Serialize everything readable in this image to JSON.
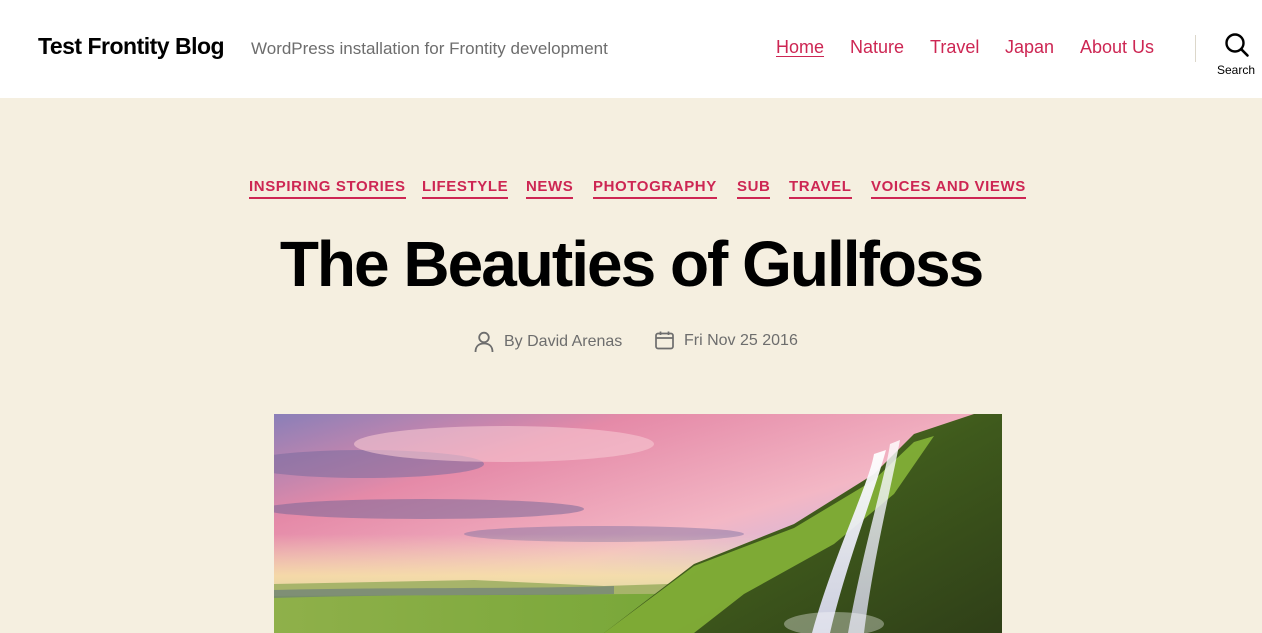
{
  "header": {
    "site_title": "Test Frontity Blog",
    "site_description": "WordPress installation for Frontity development",
    "nav": [
      {
        "label": "Home",
        "active": true
      },
      {
        "label": "Nature",
        "active": false
      },
      {
        "label": "Travel",
        "active": false
      },
      {
        "label": "Japan",
        "active": false
      },
      {
        "label": "About Us",
        "active": false
      }
    ],
    "search_label": "Search",
    "search_icon": "search-icon"
  },
  "post": {
    "categories": [
      "INSPIRING STORIES",
      "LIFESTYLE",
      "NEWS",
      "PHOTOGRAPHY",
      "SUB",
      "TRAVEL",
      "VOICES AND VIEWS"
    ],
    "title": "The Beauties of Gullfoss",
    "author": "By David Arenas",
    "date": "Fri Nov 25 2016",
    "author_icon": "user-icon",
    "date_icon": "calendar-icon",
    "featured_image": "waterfall landscape"
  },
  "colors": {
    "accent": "#cd2653",
    "background": "#f5efe0",
    "header_bg": "#ffffff",
    "muted_text": "#6d6d6d"
  }
}
